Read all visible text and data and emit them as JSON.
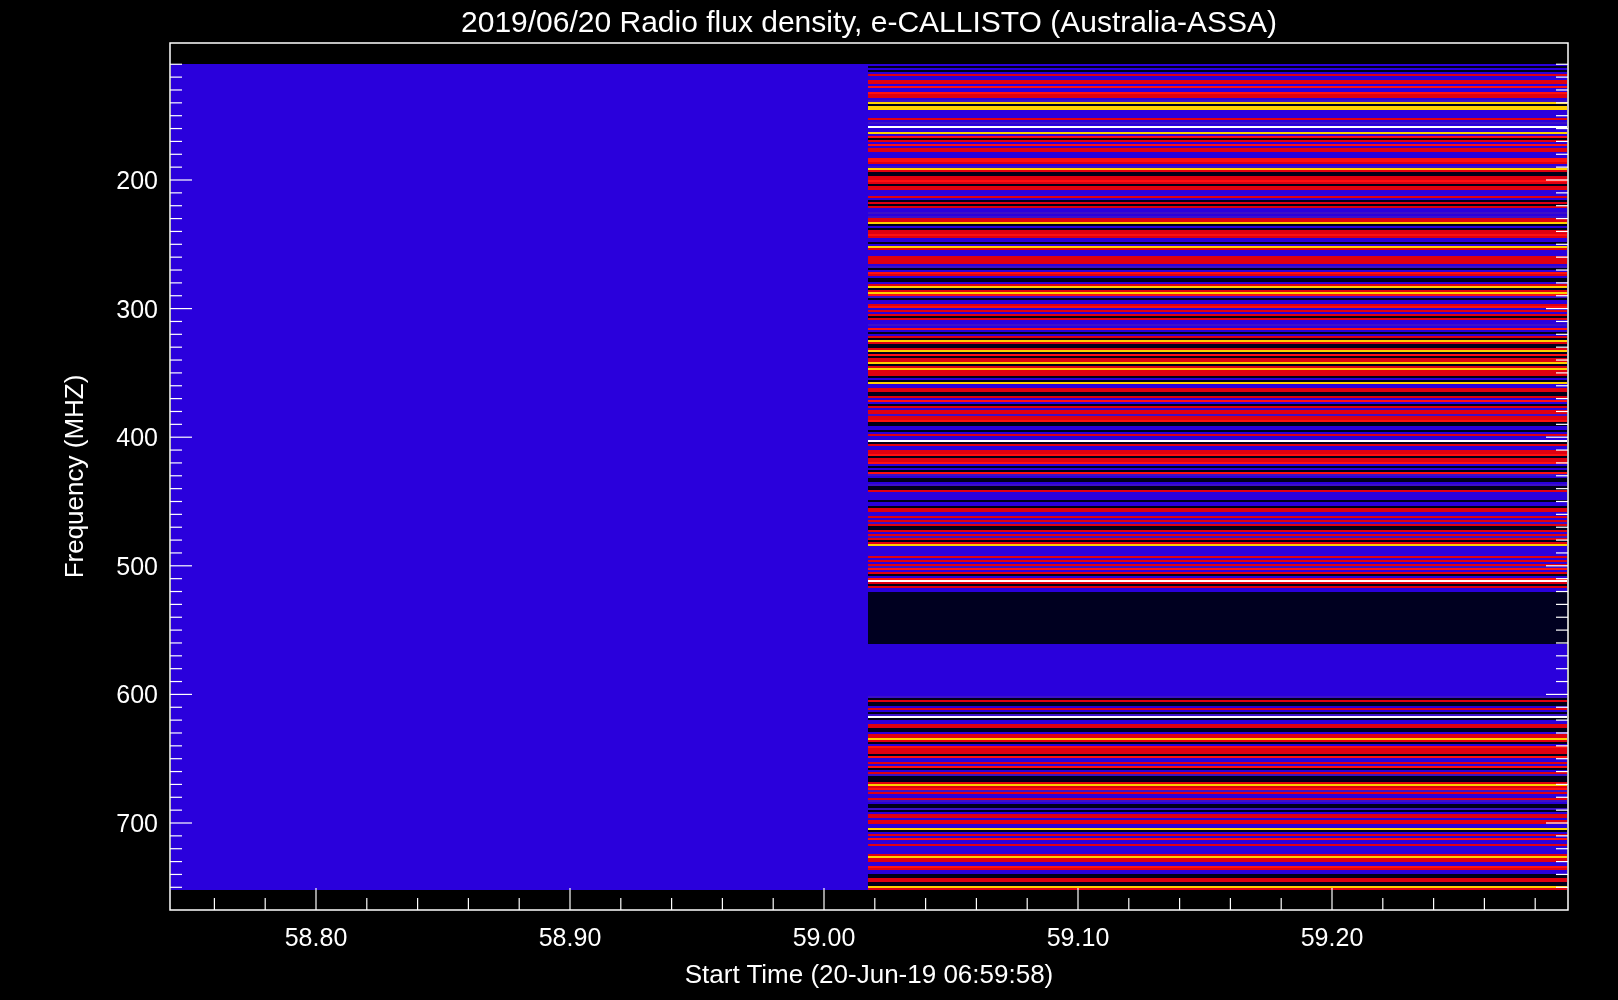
{
  "title": "2019/06/20  Radio flux density, e-CALLISTO (Australia-ASSA)",
  "plot": {
    "x_axis": {
      "label": "Start Time (20-Jun-19 06:59:58)",
      "ticks": [
        "58.80",
        "58.90",
        "59.00",
        "59.10",
        "59.20"
      ]
    },
    "y_axis": {
      "label": "Frequency (MHZ)",
      "ticks": [
        "200",
        "300",
        "400",
        "500",
        "600",
        "700"
      ]
    }
  }
}
